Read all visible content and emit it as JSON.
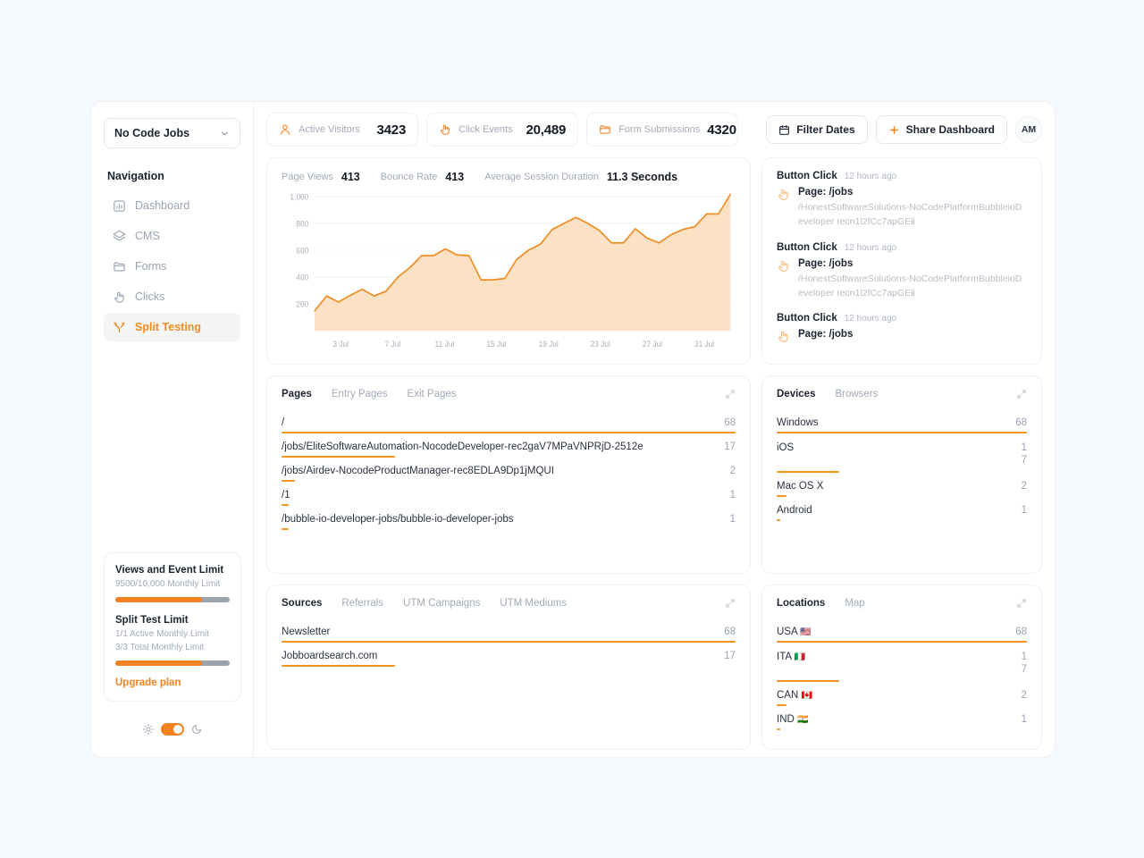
{
  "sidebar": {
    "site_selector": {
      "label": "No Code Jobs",
      "icon": "chevron-down-icon"
    },
    "nav_title": "Navigation",
    "items": [
      {
        "label": "Dashboard",
        "icon": "bar-chart-icon",
        "active": false
      },
      {
        "label": "CMS",
        "icon": "layers-icon",
        "active": false
      },
      {
        "label": "Forms",
        "icon": "folder-icon",
        "active": false
      },
      {
        "label": "Clicks",
        "icon": "click-icon",
        "active": false
      },
      {
        "label": "Split Testing",
        "icon": "split-icon",
        "active": true
      }
    ],
    "limits": {
      "views_title": "Views and Event Limit",
      "views_sub": "9500/10,000 Monthly Limit",
      "views_percent": 76,
      "split_title": "Split Test Limit",
      "split_sub1": "1/1 Active Monthly Limit",
      "split_sub2": "3/3 Total Monthly Limit",
      "split_percent": 76,
      "upgrade_label": "Upgrade plan"
    },
    "theme": {
      "light_icon": "sun-icon",
      "dark_icon": "moon-icon",
      "dark_mode_on": true
    }
  },
  "topbar": {
    "stats": [
      {
        "label": "Active Visitors",
        "value": "3423",
        "icon": "user-icon"
      },
      {
        "label": "Click Events",
        "value": "20,489",
        "icon": "click-icon"
      },
      {
        "label": "Form Submissions",
        "value": "4320",
        "icon": "folder-icon"
      }
    ],
    "filter_dates_label": "Filter Dates",
    "filter_dates_icon": "calendar-icon",
    "share_label": "Share Dashboard",
    "share_icon": "plus-icon",
    "avatar_initials": "AM"
  },
  "chart_panel": {
    "stats": [
      {
        "label": "Page Views",
        "value": "413"
      },
      {
        "label": "Bounce Rate",
        "value": "413"
      },
      {
        "label": "Average Session Duration",
        "value": "11.3 Seconds"
      }
    ]
  },
  "chart_data": {
    "type": "area",
    "title": "Page Views",
    "xlabel": "",
    "ylabel": "",
    "ylim": [
      0,
      1000
    ],
    "yticks": [
      200,
      400,
      600,
      800,
      1000
    ],
    "ytick_labels": [
      "200",
      "400",
      "600",
      "800",
      "1,000"
    ],
    "grid": true,
    "legend": "none",
    "line_color": "#f08c22",
    "fill_color": "#fbdcbb",
    "x": [
      "1 Jul",
      "2 Jul",
      "3 Jul",
      "4 Jul",
      "5 Jul",
      "6 Jul",
      "7 Jul",
      "8 Jul",
      "9 Jul",
      "10 Jul",
      "11 Jul",
      "12 Jul",
      "13 Jul",
      "14 Jul",
      "15 Jul",
      "16 Jul",
      "17 Jul",
      "18 Jul",
      "19 Jul",
      "20 Jul",
      "21 Jul",
      "22 Jul",
      "23 Jul",
      "24 Jul",
      "25 Jul",
      "26 Jul",
      "27 Jul",
      "28 Jul",
      "29 Jul",
      "30 Jul",
      "31 Jul",
      "1 Aug"
    ],
    "xtick_labels": [
      "3 Jul",
      "7 Jul",
      "11 Jul",
      "15 Jul",
      "19 Jul",
      "23 Jul",
      "27 Jul",
      "31 Jul"
    ],
    "values": [
      150,
      260,
      215,
      265,
      310,
      260,
      295,
      400,
      470,
      560,
      560,
      610,
      565,
      560,
      380,
      380,
      390,
      530,
      600,
      645,
      755,
      800,
      845,
      800,
      745,
      655,
      655,
      760,
      690,
      655,
      715,
      755,
      775,
      870,
      870,
      1015
    ]
  },
  "events_panel": {
    "events": [
      {
        "title": "Button Click",
        "time": "12 hours ago",
        "icon": "click-icon",
        "page": "Page: /jobs",
        "url": "/HonestSoftwareSolutions-NoCodePlatformBubbleioDeveloper recn1l2fCc7apGEii"
      },
      {
        "title": "Button Click",
        "time": "12 hours ago",
        "icon": "click-icon",
        "page": "Page: /jobs",
        "url": "/HonestSoftwareSolutions-NoCodePlatformBubbleioDeveloper recn1l2fCc7apGEii"
      },
      {
        "title": "Button Click",
        "time": "12 hours ago",
        "icon": "click-icon",
        "page": "Page: /jobs",
        "url": ""
      }
    ]
  },
  "pages_panel": {
    "tabs": [
      {
        "label": "Pages",
        "active": true
      },
      {
        "label": "Entry Pages",
        "active": false
      },
      {
        "label": "Exit Pages",
        "active": false
      }
    ],
    "expand_icon": "expand-icon",
    "rows": [
      {
        "label": "/",
        "value": "68",
        "percent": 100
      },
      {
        "label": "/jobs/EliteSoftwareAutomation-NocodeDeveloper-rec2gaV7MPaVNPRjD-2512e",
        "value": "17",
        "percent": 25
      },
      {
        "label": "/jobs/Airdev-NocodeProductManager-rec8EDLA9Dp1jMQUI",
        "value": "2",
        "percent": 3
      },
      {
        "label": "/1",
        "value": "1",
        "percent": 1.5
      },
      {
        "label": "/bubble-io-developer-jobs/bubble-io-developer-jobs",
        "value": "1",
        "percent": 1.5
      }
    ]
  },
  "devices_panel": {
    "tabs": [
      {
        "label": "Devices",
        "active": true
      },
      {
        "label": "Browsers",
        "active": false
      }
    ],
    "expand_icon": "expand-icon",
    "rows": [
      {
        "label": "Windows",
        "value": "68",
        "percent": 100
      },
      {
        "label": "iOS",
        "value": "17",
        "percent": 25,
        "wrap": true
      },
      {
        "label": "Mac OS X",
        "value": "2",
        "percent": 4
      },
      {
        "label": "Android",
        "value": "1",
        "percent": 1.5
      }
    ]
  },
  "sources_panel": {
    "tabs": [
      {
        "label": "Sources",
        "active": true
      },
      {
        "label": "Referrals",
        "active": false
      },
      {
        "label": "UTM Campaigns",
        "active": false
      },
      {
        "label": "UTM Mediums",
        "active": false
      }
    ],
    "expand_icon": "expand-icon",
    "rows": [
      {
        "label": "Newsletter",
        "value": "68",
        "percent": 100
      },
      {
        "label": "Jobboardsearch.com",
        "value": "17",
        "percent": 25
      }
    ]
  },
  "locations_panel": {
    "tabs": [
      {
        "label": "Locations",
        "active": true
      },
      {
        "label": "Map",
        "active": false
      }
    ],
    "expand_icon": "expand-icon",
    "rows": [
      {
        "label": "USA",
        "flag": "🇺🇸",
        "value": "68",
        "percent": 100
      },
      {
        "label": "ITA",
        "flag": "🇮🇹",
        "value": "17",
        "percent": 25,
        "wrap": true
      },
      {
        "label": "CAN",
        "flag": "🇨🇦",
        "value": "2",
        "percent": 4
      },
      {
        "label": "IND",
        "flag": "🇮🇳",
        "value": "1",
        "percent": 1.5
      }
    ]
  }
}
